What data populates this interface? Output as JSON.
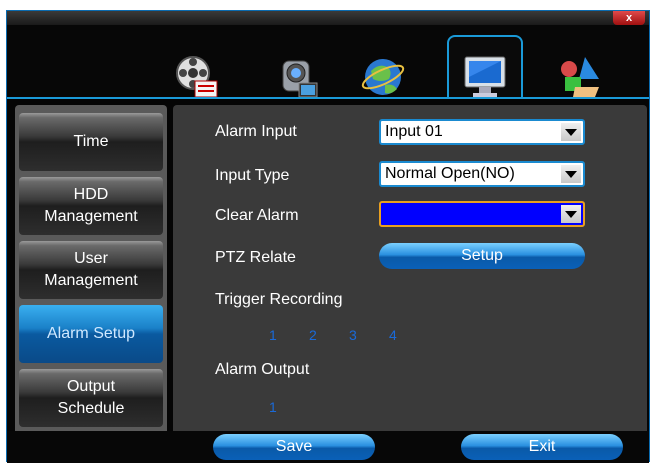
{
  "window": {
    "close_label": "x"
  },
  "top_icons": [
    "record-icon",
    "camera-icon",
    "network-globe-icon",
    "monitor-icon",
    "shapes-icon"
  ],
  "sidebar": {
    "items": [
      {
        "line1": "Time",
        "line2": ""
      },
      {
        "line1": "HDD",
        "line2": "Management"
      },
      {
        "line1": "User",
        "line2": "Management"
      },
      {
        "line1": "Alarm Setup",
        "line2": ""
      },
      {
        "line1": "Output",
        "line2": "Schedule"
      }
    ]
  },
  "form": {
    "alarm_input_label": "Alarm Input",
    "alarm_input_value": "Input 01",
    "input_type_label": "Input Type",
    "input_type_value": "Normal Open(NO)",
    "clear_alarm_label": "Clear Alarm",
    "clear_alarm_value": "",
    "ptz_label": "PTZ Relate",
    "ptz_button": "Setup",
    "trigger_label": "Trigger Recording",
    "trigger_channels": [
      "1",
      "2",
      "3",
      "4"
    ],
    "output_label": "Alarm Output",
    "output_channels": [
      "1"
    ]
  },
  "footer": {
    "save": "Save",
    "exit": "Exit"
  },
  "colors": {
    "accent": "#1a9ad8",
    "active": "#1a80c8",
    "channel": "#1a6ad8"
  }
}
